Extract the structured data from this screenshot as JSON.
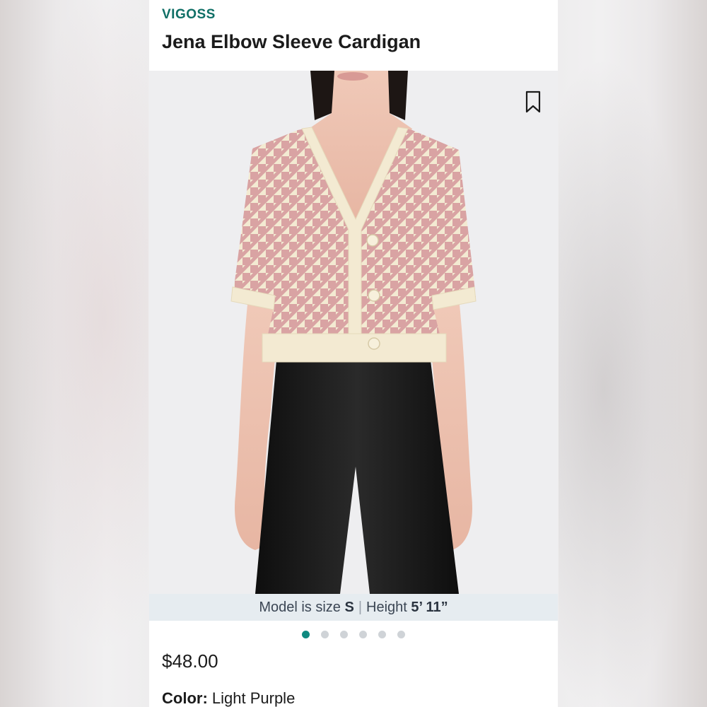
{
  "product": {
    "brand": "VIGOSS",
    "name": "Jena Elbow Sleeve Cardigan",
    "price": "$48.00"
  },
  "gallery": {
    "image_description_icon": "product-photo",
    "bookmark_icon": "bookmark-icon",
    "dot_count": 6,
    "active_dot": 0
  },
  "model_info": {
    "size_prefix": "Model is size ",
    "size_value": "S",
    "separator": "|",
    "height_prefix": "Height ",
    "height_value": "5’ 11”"
  },
  "color": {
    "label": "Color:",
    "value": "Light Purple"
  },
  "colors": {
    "brand": "#0f6f66",
    "accent_dot": "#0f8a80",
    "cardigan_pink": "#d9a3a3",
    "cardigan_cream": "#f3ead2",
    "pants_black": "#151515"
  }
}
